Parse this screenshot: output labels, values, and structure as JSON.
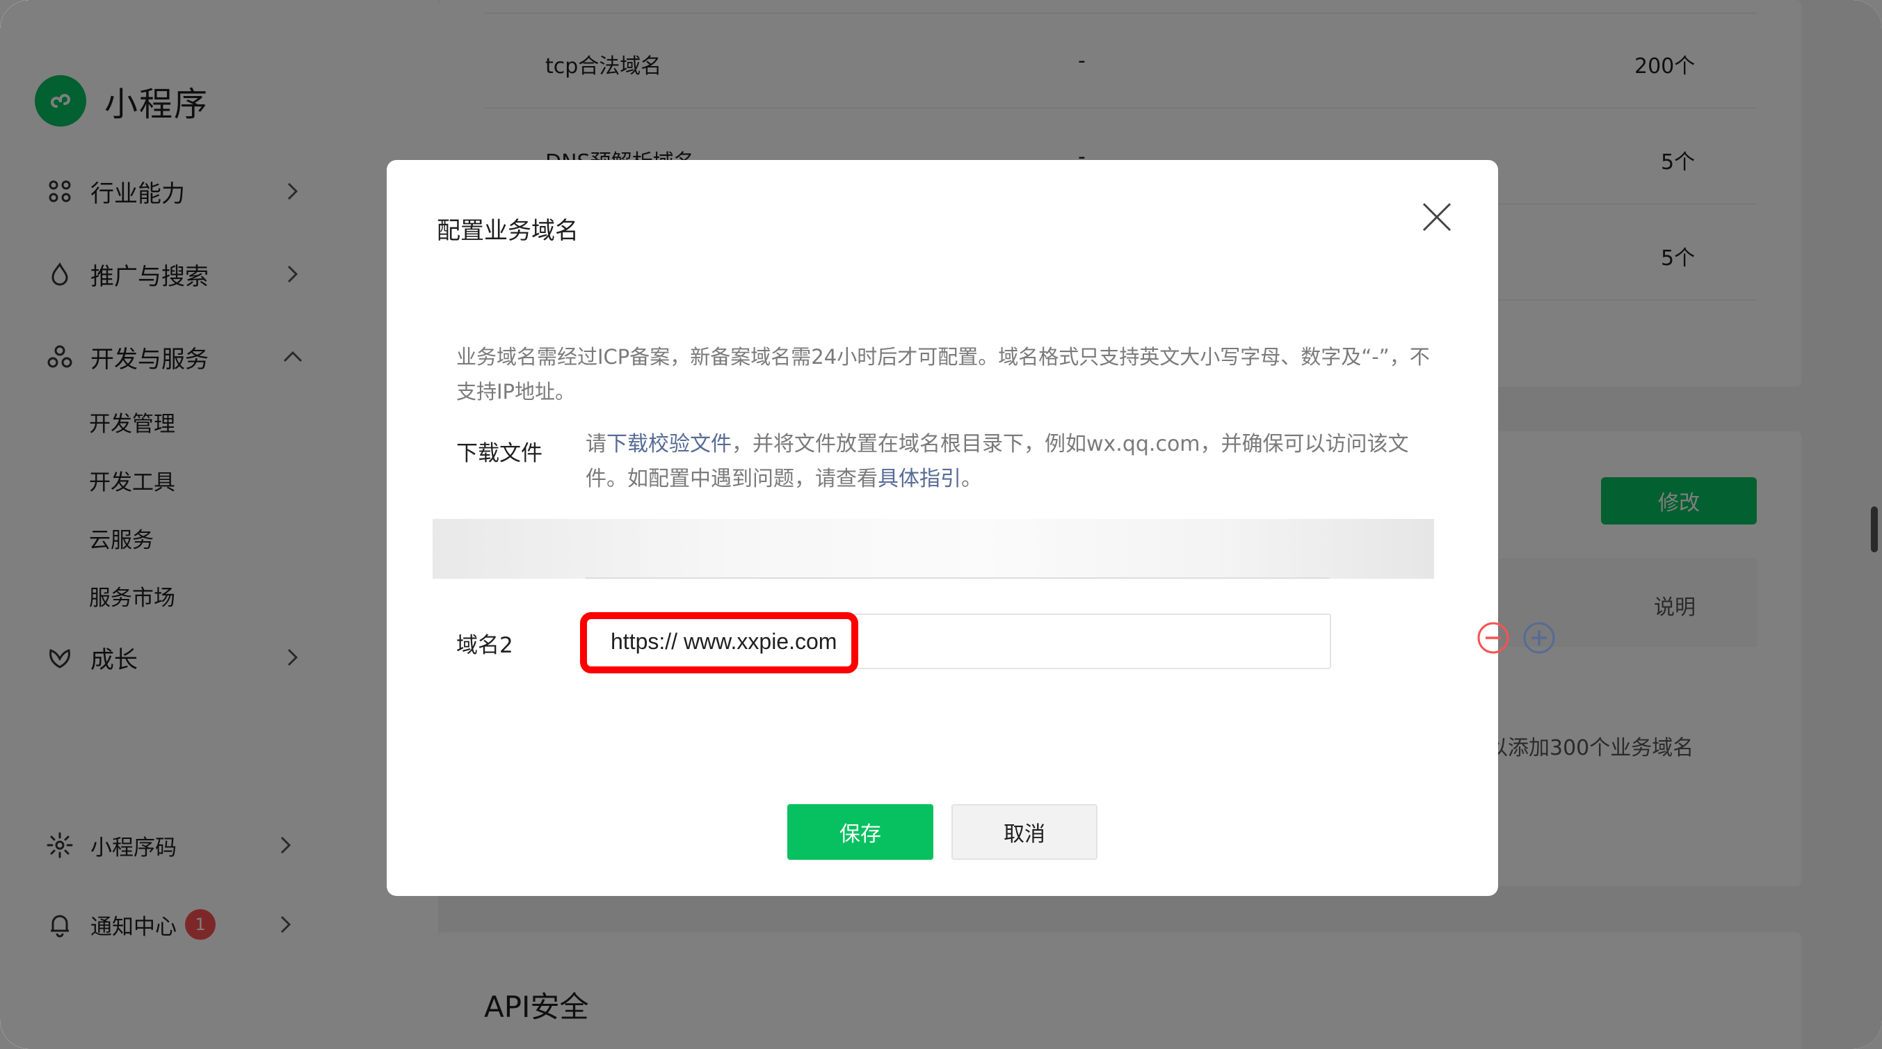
{
  "sidebar": {
    "logo_text": "小程序",
    "items": [
      {
        "label": "行业能力"
      },
      {
        "label": "推广与搜索"
      },
      {
        "label": "开发与服务"
      },
      {
        "label": "成长"
      },
      {
        "label": "小程序码"
      },
      {
        "label": "通知中心",
        "badge": "1"
      }
    ],
    "sub_items": [
      "开发管理",
      "开发工具",
      "云服务",
      "服务市场"
    ]
  },
  "background": {
    "rows": [
      {
        "name": "tcp合法域名",
        "value": "-",
        "count": "200个"
      },
      {
        "name": "DNS预解析域名",
        "value": "-",
        "count": "5个"
      },
      {
        "name": "",
        "value": "",
        "count": "5个"
      }
    ],
    "edit_button": "修改",
    "table_header_note": "说明",
    "hint": "以添加300个业务域名",
    "api_title": "API安全"
  },
  "dialog": {
    "title": "配置业务域名",
    "notice": "业务域名需经过ICP备案，新备案域名需24小时后才可配置。域名格式只支持英文大小写字母、数字及“-”，不支持IP地址。",
    "download_label": "下载文件",
    "download_text_1": "请",
    "download_link": "下载校验文件",
    "download_text_2": "，并将文件放置在域名根目录下，例如wx.qq.com，并确保可以访问该文件。如配置中遇到问题，请查看",
    "guide_link": "具体指引",
    "download_text_3": "。",
    "field_label": "域名2",
    "field_value": "https:// www.xxpie.com",
    "save_label": "保存",
    "cancel_label": "取消"
  },
  "colors": {
    "brand_green": "#07c160",
    "highlight_red": "#ff0000",
    "link_blue": "#576b95",
    "badge_red": "#fa5151"
  }
}
